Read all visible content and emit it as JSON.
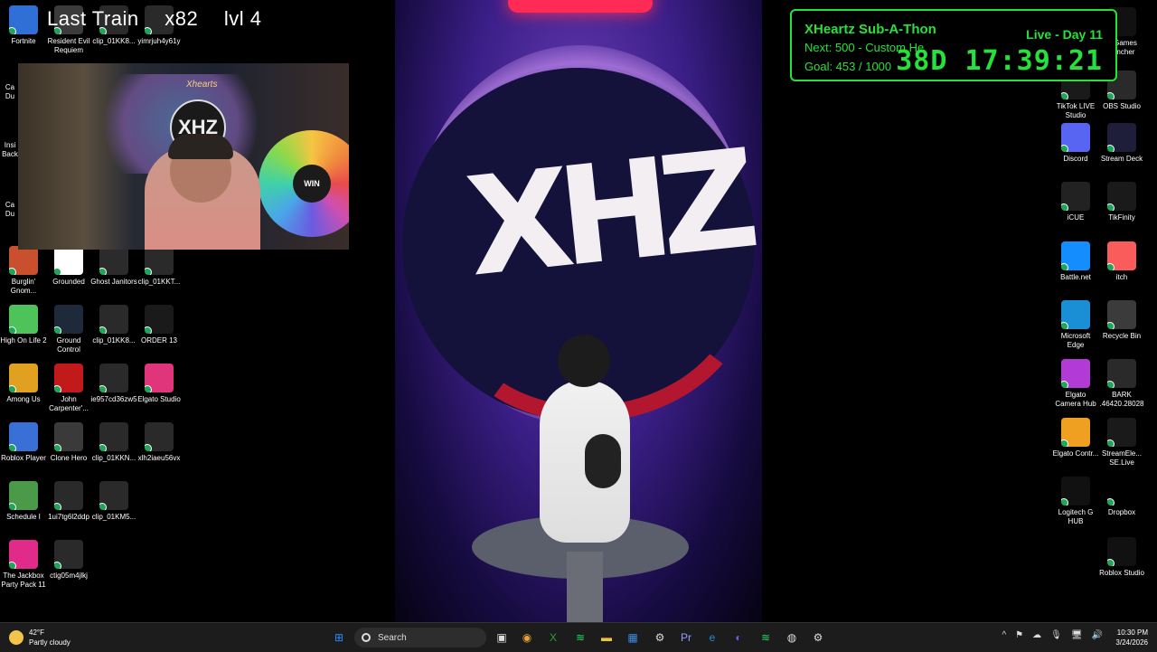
{
  "overlay": {
    "train_title": "Last Train",
    "train_multiplier": "x82",
    "train_level": "lvl 4"
  },
  "webcam": {
    "tag_text": "Xhearts",
    "logo_text": "XHZ",
    "wheel_hub_text": "WIN"
  },
  "stream": {
    "brand_text": "XHZ"
  },
  "subathon": {
    "title": "XHeartz Sub-A-Thon",
    "next": "Next: 500 - Custom Hea",
    "goal": "Goal: 453 / 1000",
    "live": "Live - Day 11",
    "timer": "38D 17:39:21"
  },
  "desktop_left": [
    {
      "label": "Fortnite",
      "icon": "fortnite-icon",
      "color": "#2f6fd6"
    },
    {
      "label": "Resident Evil Requiem",
      "icon": "resident-evil-icon",
      "color": "#3b3b3b"
    },
    {
      "label": "clip_01KK8...",
      "icon": "clip-icon",
      "color": "#2a2a2a"
    },
    {
      "label": "yimrjuh4y61y",
      "icon": "clip-icon",
      "color": "#2a2a2a"
    },
    {
      "label": "Burglin' Gnom...",
      "icon": "burglin-gnomes-icon",
      "color": "#c8502e"
    },
    {
      "label": "Grounded",
      "icon": "grounded-icon",
      "color": "#ffffff"
    },
    {
      "label": "Ghost Janitors",
      "icon": "ghost-janitors-icon",
      "color": "#2b2b2b"
    },
    {
      "label": "clip_01KKT...",
      "icon": "clip-icon",
      "color": "#2a2a2a"
    },
    {
      "label": "High On Life 2",
      "icon": "high-on-life-icon",
      "color": "#4ec35a"
    },
    {
      "label": "Ground Control",
      "icon": "ground-control-icon",
      "color": "#1e2a3a"
    },
    {
      "label": "clip_01KK8...",
      "icon": "clip-icon",
      "color": "#2a2a2a"
    },
    {
      "label": "ORDER 13",
      "icon": "order-13-icon",
      "color": "#1a1a1a"
    },
    {
      "label": "Among Us",
      "icon": "among-us-icon",
      "color": "#e0a020"
    },
    {
      "label": "John Carpenter'...",
      "icon": "john-carpenter-icon",
      "color": "#c21a1a"
    },
    {
      "label": "ie957cd36zw5",
      "icon": "clip-icon",
      "color": "#2a2a2a"
    },
    {
      "label": "Elgato Studio",
      "icon": "elgato-studio-icon",
      "color": "#e0357a"
    },
    {
      "label": "Roblox Player",
      "icon": "roblox-player-icon",
      "color": "#3a6fd6"
    },
    {
      "label": "Clone Hero",
      "icon": "clone-hero-icon",
      "color": "#3a3a3a"
    },
    {
      "label": "clip_01KKN...",
      "icon": "clip-icon",
      "color": "#2a2a2a"
    },
    {
      "label": "xlh2iaeu56vx",
      "icon": "clip-icon",
      "color": "#2a2a2a"
    },
    {
      "label": "Schedule I",
      "icon": "schedule-i-icon",
      "color": "#4a9a4a"
    },
    {
      "label": "1ui7tg6l2ddp",
      "icon": "clip-icon",
      "color": "#2a2a2a"
    },
    {
      "label": "clip_01KM5...",
      "icon": "clip-icon",
      "color": "#2a2a2a"
    },
    {
      "label": "The Jackbox Party Pack 11",
      "icon": "jackbox-icon",
      "color": "#e02b8a"
    },
    {
      "label": "ctig05m4jlkj",
      "icon": "clip-icon",
      "color": "#2a2a2a"
    }
  ],
  "desktop_partial": [
    "Ca Du",
    "Insi Back",
    "Ca Du"
  ],
  "desktop_right": [
    {
      "label": "ic Games auncher",
      "icon": "epic-games-icon",
      "color": "#111111"
    },
    {
      "label": "TikTok LIVE Studio",
      "icon": "tiktok-live-icon",
      "color": "#1a1a1a"
    },
    {
      "label": "OBS Studio",
      "icon": "obs-studio-icon",
      "color": "#2a2a2a"
    },
    {
      "label": "Discord",
      "icon": "discord-icon",
      "color": "#5865f2"
    },
    {
      "label": "Stream Deck",
      "icon": "stream-deck-icon",
      "color": "#1e1e3a"
    },
    {
      "label": "iCUE",
      "icon": "icue-icon",
      "color": "#222222"
    },
    {
      "label": "TikFinity",
      "icon": "tikfinity-icon",
      "color": "#1a1a1a"
    },
    {
      "label": "Battle.net",
      "icon": "battle-net-icon",
      "color": "#148eff"
    },
    {
      "label": "itch",
      "icon": "itch-icon",
      "color": "#fa5c5c"
    },
    {
      "label": "Microsoft Edge",
      "icon": "edge-icon",
      "color": "#1a8fd6"
    },
    {
      "label": "Recycle Bin",
      "icon": "recycle-bin-icon",
      "color": "#3b3b3b"
    },
    {
      "label": "Elgato Camera Hub",
      "icon": "elgato-camera-hub-icon",
      "color": "#b23bd6"
    },
    {
      "label": "BARK .46420.28028",
      "icon": "bark-icon",
      "color": "#2a2a2a"
    },
    {
      "label": "Elgato Contr...",
      "icon": "elgato-control-icon",
      "color": "#f0a020"
    },
    {
      "label": "StreamEle... SE.Live",
      "icon": "streamelements-icon",
      "color": "#1a1a1a"
    },
    {
      "label": "Logitech G HUB",
      "icon": "logitech-g-hub-icon",
      "color": "#111111"
    },
    {
      "label": "Dropbox",
      "icon": "dropbox-icon",
      "color": "#000000"
    },
    {
      "label": "Roblox Studio",
      "icon": "roblox-studio-icon",
      "color": "#111111"
    }
  ],
  "taskbar": {
    "weather_temp": "42°F",
    "weather_desc": "Partly cloudy",
    "search_placeholder": "Search",
    "apps": [
      {
        "name": "windows-start-icon",
        "glyph": "⊞",
        "color": "#2b8cff"
      },
      {
        "name": "task-view-icon",
        "glyph": "▣",
        "color": "#dddddd"
      },
      {
        "name": "chrome-icon",
        "glyph": "◉",
        "color": "#e8a33a"
      },
      {
        "name": "xbox-icon",
        "glyph": "X",
        "color": "#22a33a"
      },
      {
        "name": "spotify-icon",
        "glyph": "≋",
        "color": "#1ed760"
      },
      {
        "name": "file-explorer-icon",
        "glyph": "▬",
        "color": "#f0c040"
      },
      {
        "name": "microsoft-store-icon",
        "glyph": "▦",
        "color": "#3a8ee6"
      },
      {
        "name": "settings-icon",
        "glyph": "⚙",
        "color": "#dddddd"
      },
      {
        "name": "premiere-icon",
        "glyph": "Pr",
        "color": "#9999ff"
      },
      {
        "name": "edge-taskbar-icon",
        "glyph": "e",
        "color": "#1a8fd6"
      },
      {
        "name": "discord-taskbar-icon",
        "glyph": "◐",
        "color": "#5865f2"
      },
      {
        "name": "spotify-2-icon",
        "glyph": "≋",
        "color": "#1ed760"
      },
      {
        "name": "obs-taskbar-icon",
        "glyph": "◍",
        "color": "#dddddd"
      },
      {
        "name": "steam-icon",
        "glyph": "⚙",
        "color": "#dddddd"
      }
    ],
    "tray": [
      "^",
      "⚑",
      "☁",
      "🎙",
      "🖥",
      "🔊"
    ],
    "time": "10:30 PM",
    "date": "3/24/2026"
  }
}
